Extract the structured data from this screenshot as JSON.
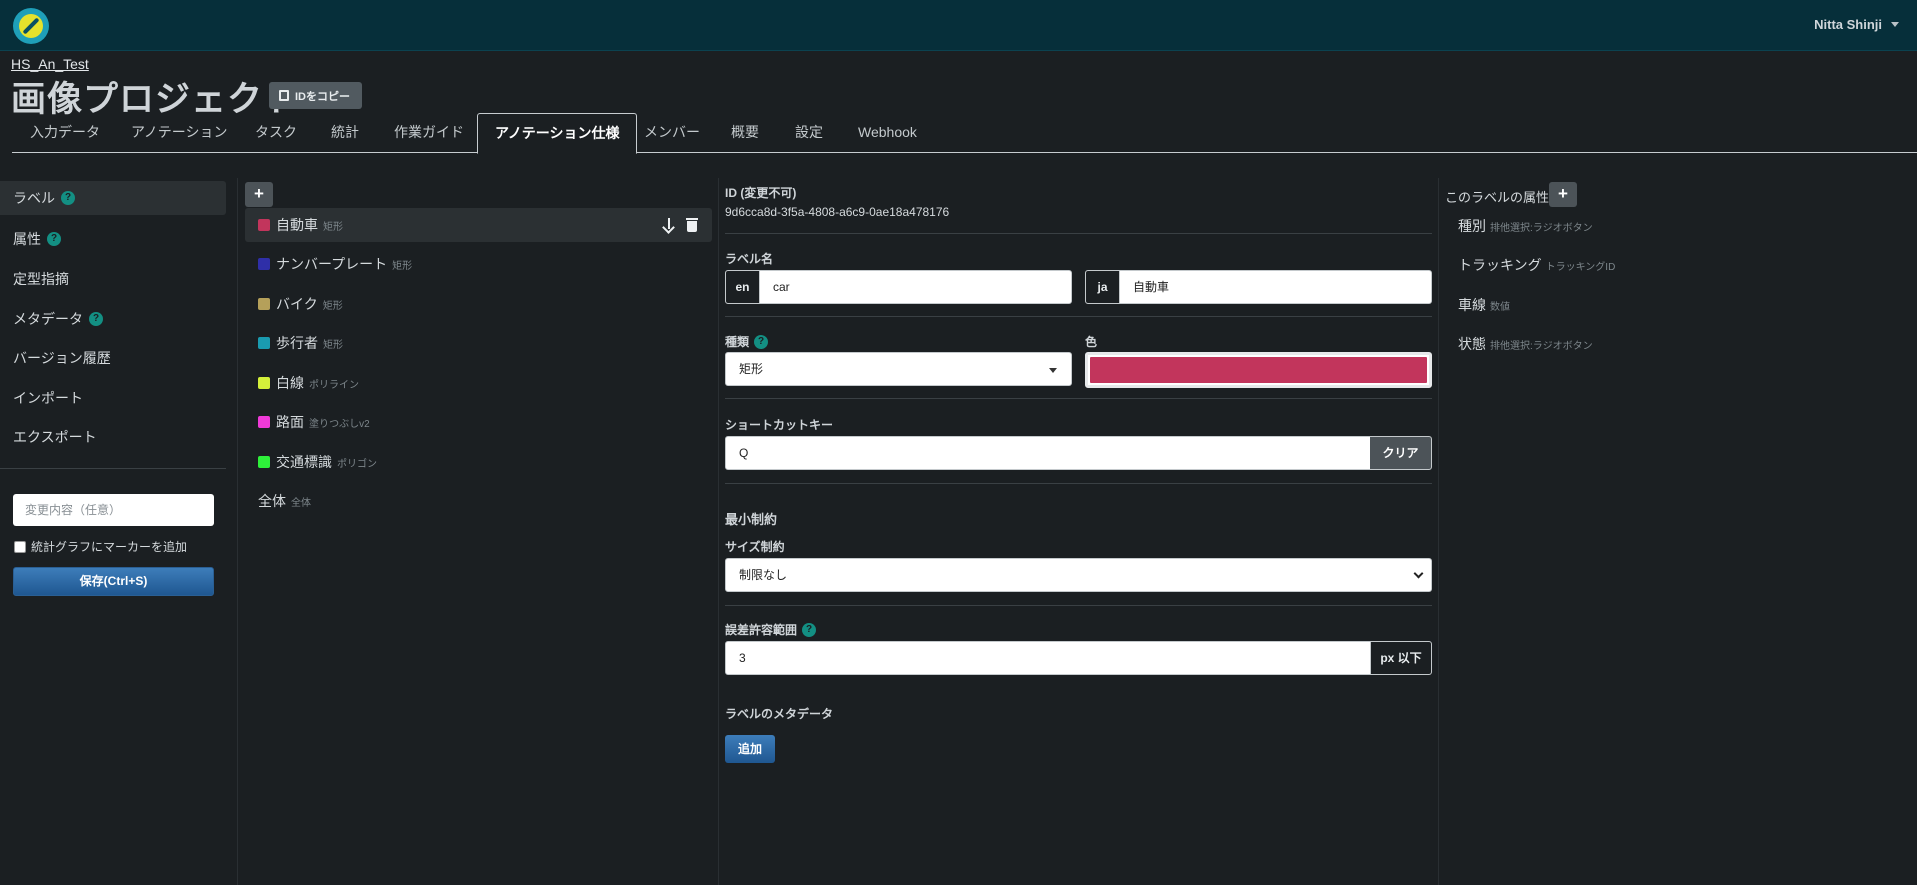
{
  "topbar": {
    "user_name": "Nitta Shinji"
  },
  "header": {
    "org": "HS_An_Test",
    "project_title": "画像プロジェクト",
    "copy_id_label": "IDをコピー"
  },
  "tabs": [
    {
      "label": "入力データ"
    },
    {
      "label": "アノテーション"
    },
    {
      "label": "タスク"
    },
    {
      "label": "統計"
    },
    {
      "label": "作業ガイド"
    },
    {
      "label": "アノテーション仕様",
      "active": true
    },
    {
      "label": "メンバー"
    },
    {
      "label": "概要"
    },
    {
      "label": "設定"
    },
    {
      "label": "Webhook"
    }
  ],
  "sidebar": {
    "items": [
      {
        "label": "ラベル",
        "help": "?"
      },
      {
        "label": "属性",
        "help": "?"
      },
      {
        "label": "定型指摘"
      },
      {
        "label": "メタデータ",
        "help": "?"
      },
      {
        "label": "バージョン履歴"
      },
      {
        "label": "インポート"
      },
      {
        "label": "エクスポート"
      }
    ],
    "memo_placeholder": "変更内容（任意）",
    "marker_checkbox_label": "統計グラフにマーカーを追加",
    "save_label": "保存(Ctrl+S)"
  },
  "labels": {
    "add_symbol": "+",
    "items": [
      {
        "name": "自動車",
        "type": "矩形",
        "color": "#c2355c"
      },
      {
        "name": "ナンバープレート",
        "type": "矩形",
        "color": "#2f2fa8"
      },
      {
        "name": "バイク",
        "type": "矩形",
        "color": "#b5a05a"
      },
      {
        "name": "歩行者",
        "type": "矩形",
        "color": "#1a9bb0"
      },
      {
        "name": "白線",
        "type": "ポリライン",
        "color": "#d4f03a"
      },
      {
        "name": "路面",
        "type": "塗りつぶしv2",
        "color": "#f03ad8"
      },
      {
        "name": "交通標識",
        "type": "ポリゴン",
        "color": "#2ef03a"
      },
      {
        "name": "全体",
        "type": "全体"
      }
    ]
  },
  "detail": {
    "id_label": "ID (変更不可)",
    "id_value": "9d6cca8d-3f5a-4808-a6c9-0ae18a478176",
    "label_name_heading": "ラベル名",
    "en_prefix": "en",
    "en_value": "car",
    "ja_prefix": "ja",
    "ja_value": "自動車",
    "kind_label": "種類",
    "kind_help": "?",
    "kind_value": "矩形",
    "color_label": "色",
    "color_value": "#c2355c",
    "shortcut_label": "ショートカットキー",
    "shortcut_value": "Q",
    "clear_label": "クリア",
    "min_constraint_heading": "最小制約",
    "size_constraint_label": "サイズ制約",
    "size_constraint_value": "制限なし",
    "tolerance_label": "誤差許容範囲",
    "tolerance_help": "?",
    "tolerance_value": "3",
    "tolerance_unit": "px 以下",
    "metadata_label": "ラベルのメタデータ",
    "add_label": "追加"
  },
  "attributes": {
    "title": "このラベルの属性",
    "add_symbol": "+",
    "items": [
      {
        "name": "種別",
        "type": "排他選択:ラジオボタン"
      },
      {
        "name": "トラッキング",
        "type": "トラッキングID"
      },
      {
        "name": "車線",
        "type": "数値"
      },
      {
        "name": "状態",
        "type": "排他選択:ラジオボタン"
      }
    ]
  }
}
